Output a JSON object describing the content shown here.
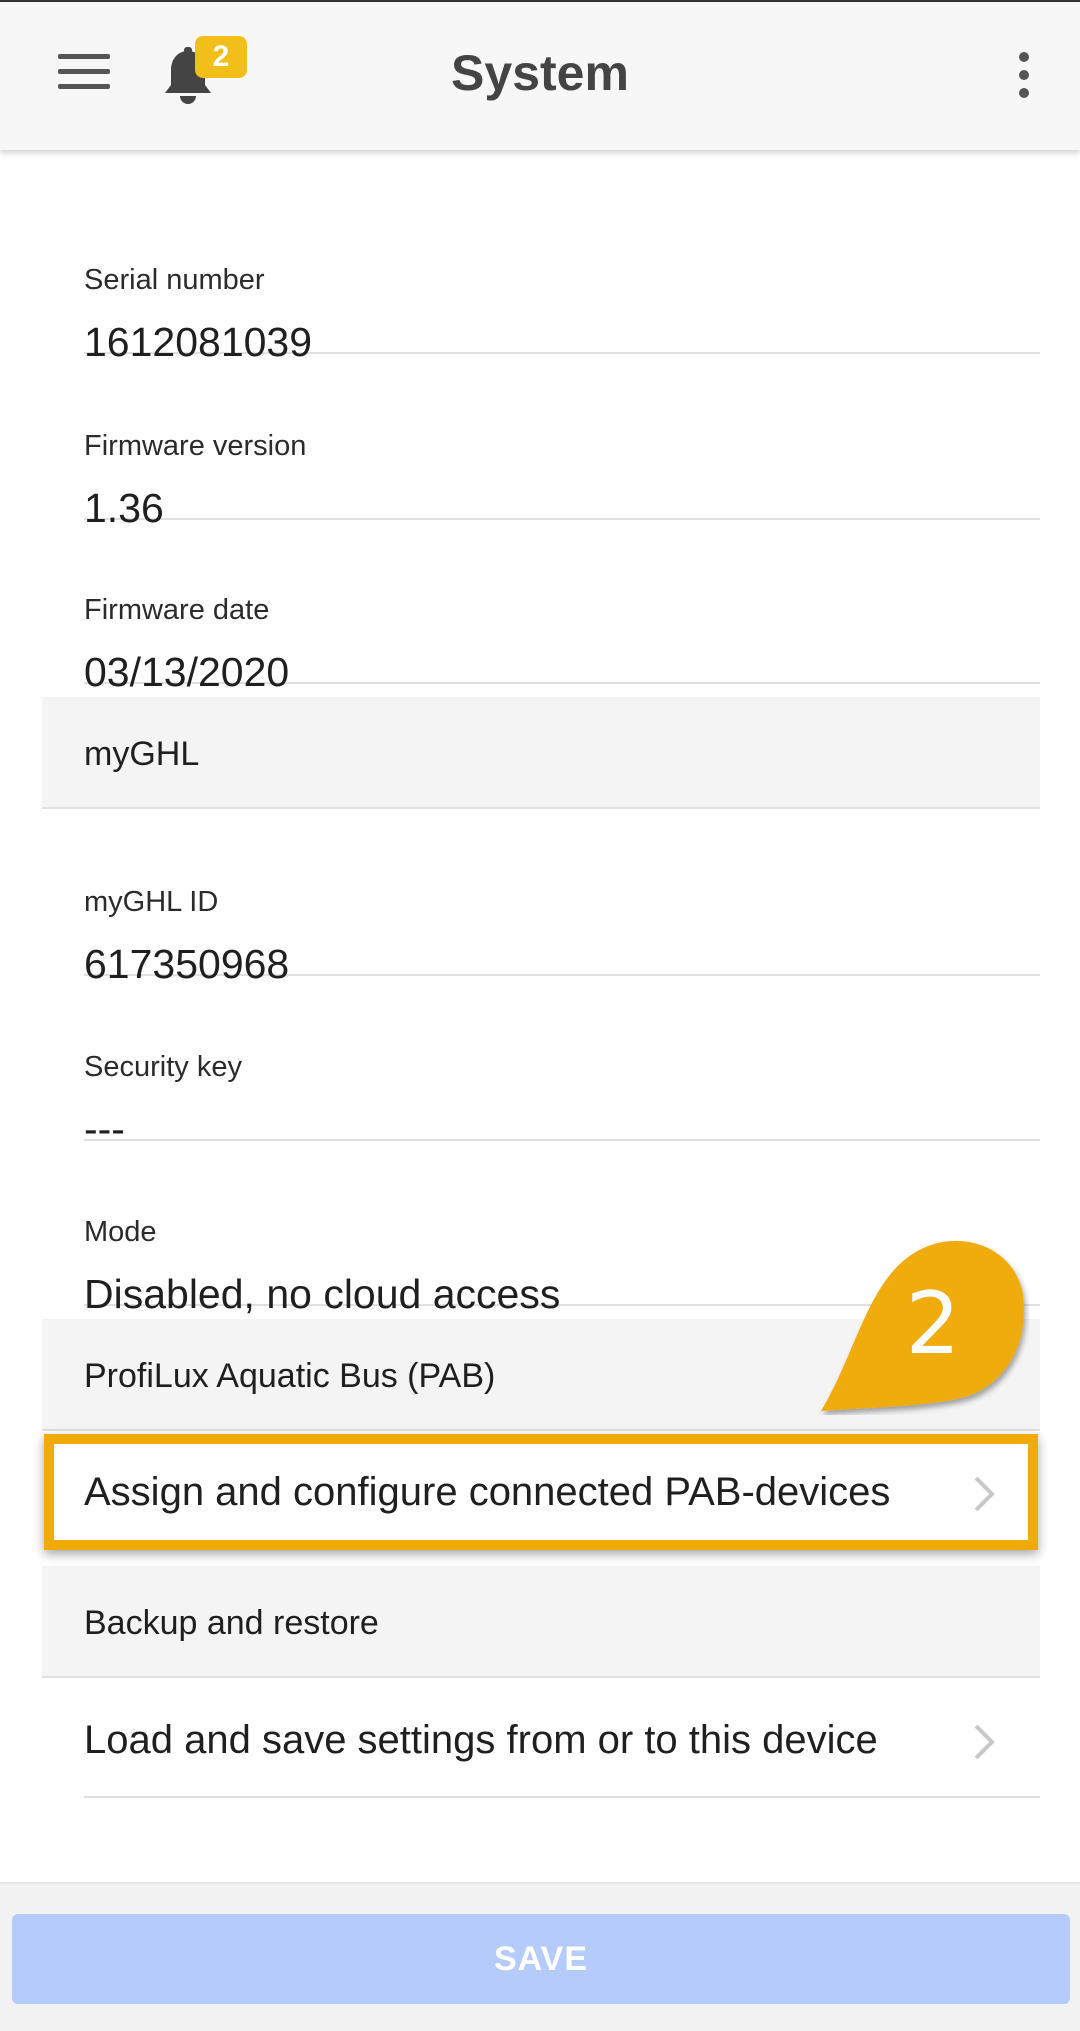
{
  "header": {
    "title": "System",
    "notification_count": "2",
    "menu_icon": "hamburger-menu-icon",
    "bell_icon": "bell-icon",
    "more_icon": "more-vert-icon"
  },
  "fields": {
    "serial_label": "Serial number",
    "serial_value": "1612081039",
    "fw_version_label": "Firmware version",
    "fw_version_value": "1.36",
    "fw_date_label": "Firmware date",
    "fw_date_value": "03/13/2020",
    "myghl_id_label": "myGHL ID",
    "myghl_id_value": "617350968",
    "security_label": "Security key",
    "security_value": "---",
    "mode_label": "Mode",
    "mode_value": "Disabled, no cloud access"
  },
  "sections": {
    "myghl": "myGHL",
    "pab": "ProfiLux Aquatic Bus (PAB)",
    "backup": "Backup and restore"
  },
  "rows": {
    "pab_devices": "Assign and configure connected PAB-devices",
    "load_save": "Load and save settings from or to this device"
  },
  "annotation": {
    "step_number": "2",
    "color": "#f0ab0a"
  },
  "footer": {
    "save_label": "SAVE"
  },
  "colors": {
    "accent": "#f0ab0a",
    "badge": "#f2be1a",
    "save_button": "#b5ccfa"
  }
}
